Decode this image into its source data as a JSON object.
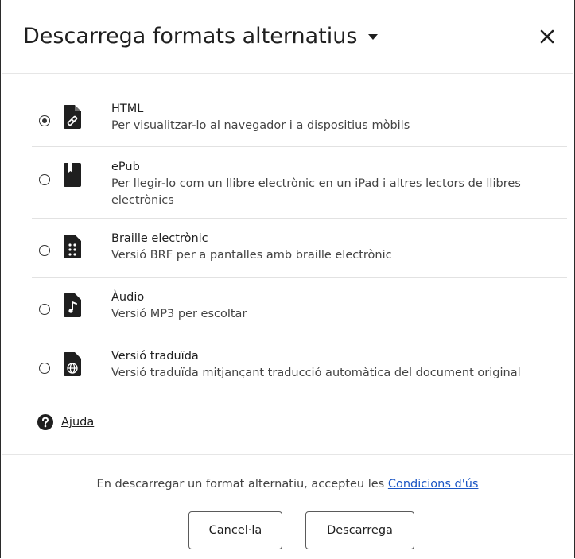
{
  "dialog": {
    "title": "Descarrega formats alternatius",
    "close_icon": "close-icon",
    "options": [
      {
        "id": "html",
        "name": "HTML",
        "description": "Per visualitzar-lo al navegador i a dispositius mòbils",
        "selected": true,
        "icon": "html-file-icon"
      },
      {
        "id": "epub",
        "name": "ePub",
        "description": "Per llegir-lo com un llibre electrònic en un iPad i altres lectors de llibres electrònics",
        "selected": false,
        "icon": "epub-book-icon"
      },
      {
        "id": "braille",
        "name": "Braille electrònic",
        "description": "Versió BRF per a pantalles amb braille electrònic",
        "selected": false,
        "icon": "braille-file-icon"
      },
      {
        "id": "audio",
        "name": "Àudio",
        "description": "Versió MP3 per escoltar",
        "selected": false,
        "icon": "audio-file-icon"
      },
      {
        "id": "translated",
        "name": "Versió traduïda",
        "description": "Versió traduïda mitjançant traducció automàtica del document original",
        "selected": false,
        "icon": "globe-file-icon"
      }
    ],
    "help": {
      "label": "Ajuda",
      "icon": "question-icon"
    },
    "footer": {
      "terms_prefix": "En descarregar un format alternatiu, accepteu les ",
      "terms_link": "Condicions d'ús",
      "cancel_label": "Cancel·la",
      "download_label": "Descarrega"
    }
  }
}
